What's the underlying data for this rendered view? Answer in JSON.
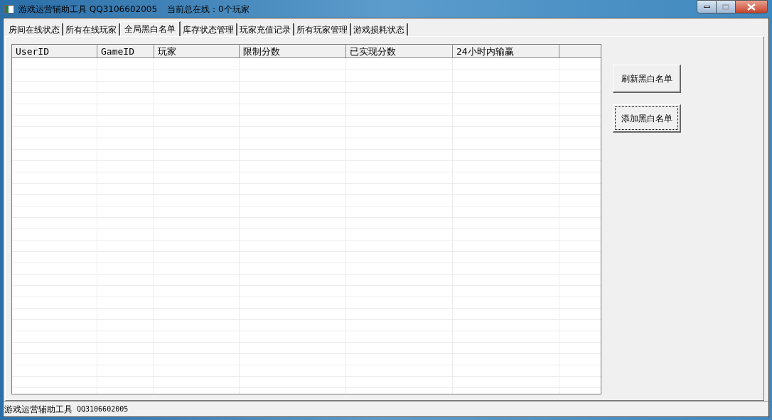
{
  "window": {
    "title": "游戏运营辅助工具 QQ3106602005",
    "online": "当前总在线：0个玩家"
  },
  "tabs": [
    {
      "label": "房间在线状态",
      "selected": false
    },
    {
      "label": "所有在线玩家",
      "selected": false
    },
    {
      "label": "全局黑白名单",
      "selected": true
    },
    {
      "label": "库存状态管理",
      "selected": false
    },
    {
      "label": "玩家充值记录",
      "selected": false
    },
    {
      "label": "所有玩家管理",
      "selected": false
    },
    {
      "label": "游戏损耗状态",
      "selected": false
    }
  ],
  "table": {
    "columns": [
      "UserID",
      "GameID",
      "玩家",
      "限制分数",
      "已实现分数",
      "24小时内输赢"
    ]
  },
  "buttons": [
    {
      "label": "刷新黑白名单",
      "focused": false
    },
    {
      "label": "添加黑白名单",
      "focused": true
    }
  ],
  "status_bar": {
    "app": "游戏运营辅助工具",
    "qq": "QQ3106602005"
  }
}
